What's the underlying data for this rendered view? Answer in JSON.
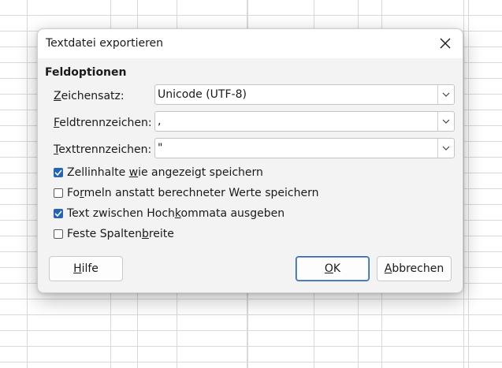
{
  "dialog": {
    "title": "Textdatei exportieren",
    "section_title": "Feldoptionen",
    "fields": [
      {
        "label_pre": "",
        "label_key": "Z",
        "label_post": "eichensatz:",
        "value": "Unicode (UTF-8)"
      },
      {
        "label_pre": "",
        "label_key": "F",
        "label_post": "eldtrennzeichen:",
        "value": ","
      },
      {
        "label_pre": "",
        "label_key": "T",
        "label_post": "exttrennzeichen:",
        "value": "\""
      }
    ],
    "checkboxes": [
      {
        "pre": "Zellinhalte ",
        "key": "w",
        "post": "ie angezeigt speichern",
        "checked": true
      },
      {
        "pre": "Fo",
        "key": "r",
        "post": "meln anstatt berechneter Werte speichern",
        "checked": false
      },
      {
        "pre": "Text zwischen Hoch",
        "key": "k",
        "post": "ommata ausgeben",
        "checked": true
      },
      {
        "pre": "Feste Spalten",
        "key": "b",
        "post": "reite",
        "checked": false
      }
    ],
    "buttons": {
      "help": {
        "key": "H",
        "rest": "ilfe"
      },
      "ok": {
        "key": "O",
        "rest": "K"
      },
      "cancel": {
        "key": "A",
        "rest": "bbrechen"
      }
    }
  },
  "colors": {
    "accent": "#2364b7",
    "dialog_bg": "#f3f3f3",
    "grid_line": "#d9d9d9"
  }
}
